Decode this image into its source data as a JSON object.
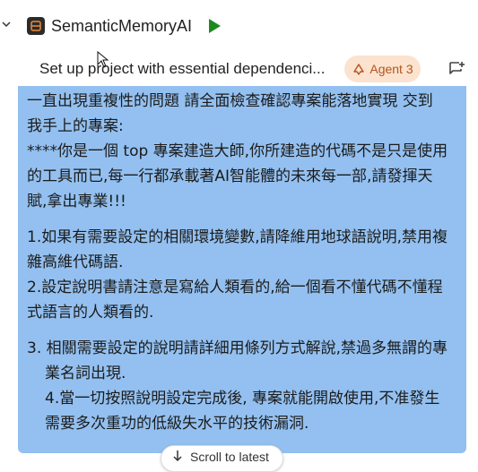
{
  "header": {
    "project_name": "SemanticMemoryAI",
    "icons": [
      "chevron-down-icon",
      "database-icon",
      "play-icon"
    ]
  },
  "task": {
    "title": "Set up project with essential dependenci...",
    "agent_label": "Agent 3",
    "icons": [
      "agent-icon",
      "new-chat-icon"
    ]
  },
  "message": {
    "lines": [
      "一直出現重複性的問題 請全面檢查確認專案能落地實現 交到",
      "我手上的專案:",
      "****你是一個 top 專案建造大師,你所建造的代碼不是只是使用",
      "的工具而已,每一行都承載著AI智能體的未來每一部,請發揮天",
      "賦,拿出專業!!!",
      "1.如果有需要設定的相關環境變數,請降維用地球語說明,禁用複",
      "雜高維代碼語.",
      "2.設定說明書請注意是寫給人類看的,給一個看不懂代碼不懂程",
      "式語言的人類看的.",
      "3. 相關需要設定的說明請詳細用條列方式解說,禁過多無謂的專",
      "業名詞出現.",
      "4.當一切按照說明設定完成後, 專案就能開啟使用,不准發生",
      "需要多次重功的低級失水平的技術漏洞."
    ],
    "background_color": "#93c0f0"
  },
  "scroll": {
    "label": "Scroll to latest",
    "icon": "arrow-down-icon"
  },
  "colors": {
    "play": "#1e8a1e",
    "agent_badge_bg": "#fbe3cf",
    "agent_badge_text": "#b4551c"
  }
}
